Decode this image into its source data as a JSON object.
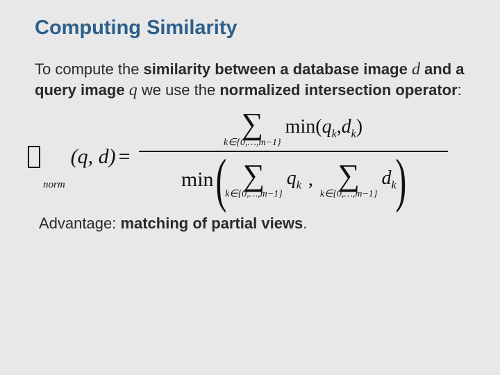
{
  "title": "Computing Similarity",
  "para": {
    "pre": "To compute the ",
    "bold1": "similarity between a database image ",
    "var_d": "d",
    "mid1": " and a query image ",
    "var_q": "q",
    "post1": " we use the ",
    "bold2": "normalized intersection operator",
    "post2": ":"
  },
  "formula": {
    "norm_sub": "norm",
    "args": "(q, d)",
    "eq": "=",
    "sum_sub": "k∈{0,…,m−1}",
    "min_fn": "min",
    "num_term_open": "min(",
    "q_k": "q",
    "d_k": "d",
    "k": "k",
    "close": ")",
    "comma": ","
  },
  "advantage": {
    "label": "Advantage: ",
    "bold": "matching of partial views",
    "period": "."
  }
}
